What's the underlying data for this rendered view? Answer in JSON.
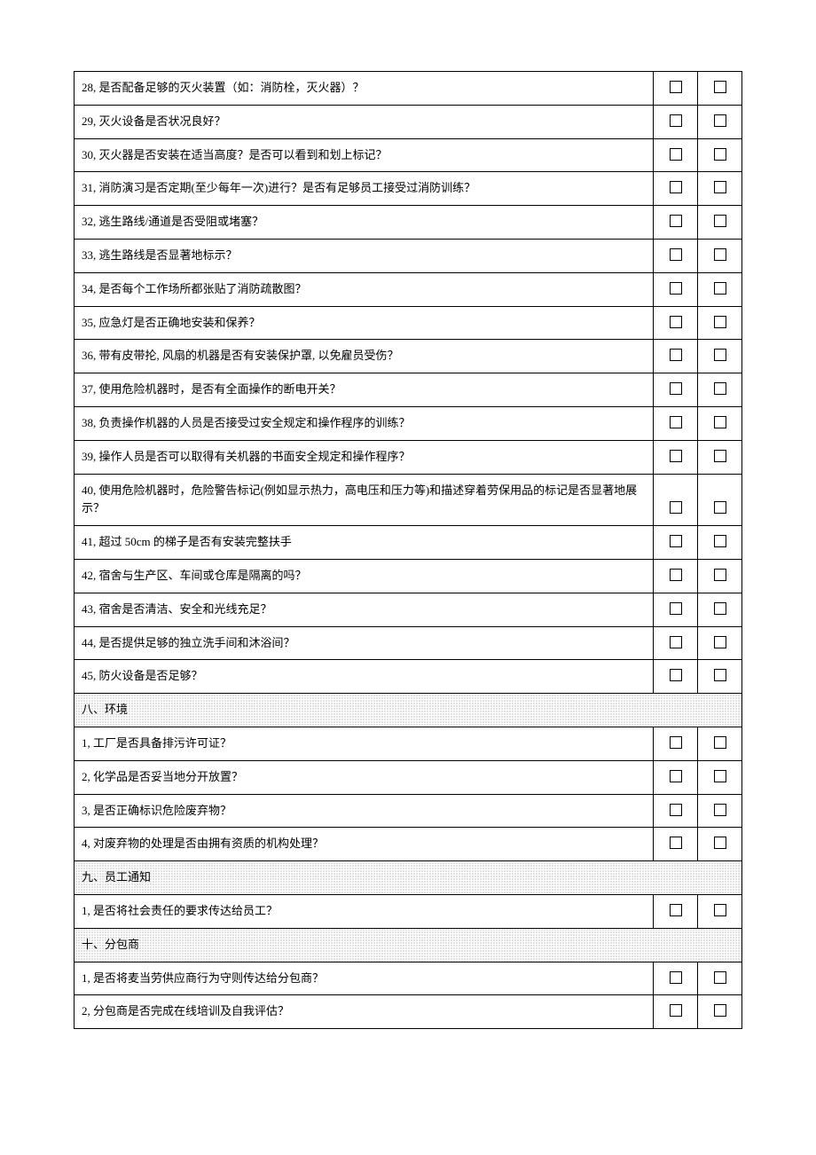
{
  "rows": [
    {
      "type": "item",
      "text": "28, 是否配备足够的灭火装置（如：消防栓，灭火器）？"
    },
    {
      "type": "item",
      "text": "29, 灭火设备是否状况良好？"
    },
    {
      "type": "item",
      "text": "30, 灭火器是否安装在适当高度？是否可以看到和划上标记？"
    },
    {
      "type": "item",
      "text": "31, 消防演习是否定期(至少每年一次)进行？是否有足够员工接受过消防训练？"
    },
    {
      "type": "item",
      "text": "32, 逃生路线/通道是否受阻或堵塞？"
    },
    {
      "type": "item",
      "text": "33, 逃生路线是否显著地标示？"
    },
    {
      "type": "item",
      "text": "34, 是否每个工作场所都张贴了消防疏散图？"
    },
    {
      "type": "item",
      "text": "35, 应急灯是否正确地安装和保养？"
    },
    {
      "type": "item",
      "text": "36, 带有皮带抡, 风扇的机器是否有安装保护罩, 以免雇员受伤？"
    },
    {
      "type": "item",
      "text": "37, 使用危险机器时，是否有全面操作的断电开关？"
    },
    {
      "type": "item",
      "text": "38, 负责操作机器的人员是否接受过安全规定和操作程序的训练？"
    },
    {
      "type": "item",
      "text": "39, 操作人员是否可以取得有关机器的书面安全规定和操作程序？"
    },
    {
      "type": "item",
      "text": "40, 使用危险机器时，危险警告标记(例如显示热力，高电压和压力等)和描述穿着劳保用品的标记是否显著地展示？"
    },
    {
      "type": "item",
      "text": "41,  超过 50cm 的梯子是否有安装完整扶手"
    },
    {
      "type": "item",
      "text": "42, 宿舍与生产区、车间或仓库是隔离的吗？"
    },
    {
      "type": "item",
      "text": "43, 宿舍是否清洁、安全和光线充足？"
    },
    {
      "type": "item",
      "text": "44, 是否提供足够的独立洗手间和沐浴间？"
    },
    {
      "type": "item",
      "text": "45, 防火设备是否足够？"
    },
    {
      "type": "section",
      "text": "八、环境"
    },
    {
      "type": "item",
      "text": "1, 工厂是否具备排污许可证？"
    },
    {
      "type": "item",
      "text": "2, 化学品是否妥当地分开放置？"
    },
    {
      "type": "item",
      "text": "3, 是否正确标识危险废弃物？"
    },
    {
      "type": "item",
      "text": "4, 对废弃物的处理是否由拥有资质的机构处理？"
    },
    {
      "type": "section",
      "text": "九、员工通知"
    },
    {
      "type": "item",
      "text": "1, 是否将社会责任的要求传达给员工？"
    },
    {
      "type": "section",
      "text": "十、分包商"
    },
    {
      "type": "item",
      "text": "1, 是否将麦当劳供应商行为守则传达给分包商？"
    },
    {
      "type": "item",
      "text": "2, 分包商是否完成在线培训及自我评估？"
    }
  ]
}
